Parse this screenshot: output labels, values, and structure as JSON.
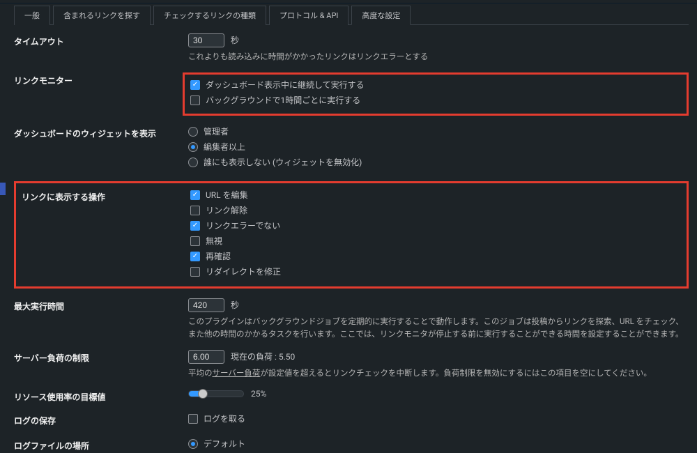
{
  "tabs": {
    "general": "一般",
    "included": "含まれるリンクを探す",
    "checked": "チェックするリンクの種類",
    "protocol": "プロトコル & API",
    "advanced": "高度な設定"
  },
  "timeout": {
    "label": "タイムアウト",
    "value": "30",
    "unit": "秒",
    "desc": "これよりも読み込みに時間がかかったリンクはリンクエラーとする"
  },
  "linkMonitor": {
    "label": "リンクモニター",
    "opt1": "ダッシュボード表示中に継続して実行する",
    "opt2": "バックグラウンドで1時間ごとに実行する"
  },
  "widget": {
    "label": "ダッシュボードのウィジェットを表示",
    "opt1": "管理者",
    "opt2": "編集者以上",
    "opt3": "誰にも表示しない (ウィジェットを無効化)"
  },
  "linkActions": {
    "label": "リンクに表示する操作",
    "opt1": "URL を編集",
    "opt2": "リンク解除",
    "opt3": "リンクエラーでない",
    "opt4": "無視",
    "opt5": "再確認",
    "opt6": "リダイレクトを修正"
  },
  "maxTime": {
    "label": "最大実行時間",
    "value": "420",
    "unit": "秒",
    "desc": "このプラグインはバックグラウンドジョブを定期的に実行することで動作します。このジョブは投稿からリンクを探索、URL をチェック、また他の時間のかかるタスクを行います。ここでは、リンクモニタが停止する前に実行することができる時間を設定することができます。"
  },
  "serverLoad": {
    "label": "サーバー負荷の制限",
    "value": "6.00",
    "current": "現在の負荷 : 5.50",
    "desc1": "平均の",
    "linked": "サーバー負荷",
    "desc2": "が設定値を超えるとリンクチェックを中断します。負荷制限を無効にするにはこの項目を空にしてください。"
  },
  "resource": {
    "label": "リソース使用率の目標値",
    "pct": "25%"
  },
  "logging": {
    "label": "ログの保存",
    "opt": "ログを取る"
  },
  "logfile": {
    "label": "ログファイルの場所",
    "opt": "デフォルト"
  }
}
